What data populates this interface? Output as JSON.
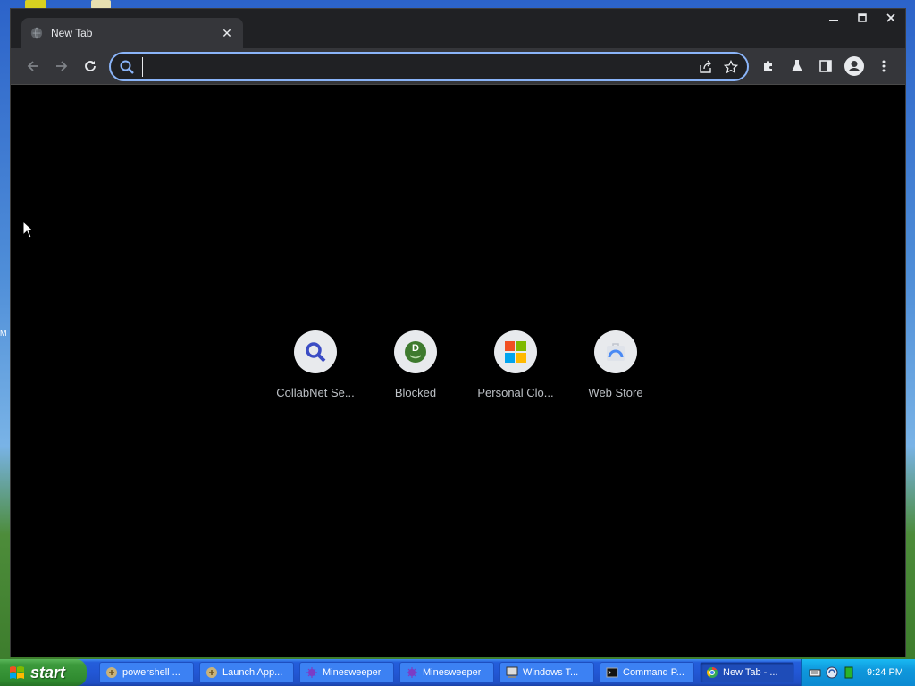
{
  "browser": {
    "tab": {
      "title": "New Tab",
      "close_glyph": "✕"
    },
    "omnibox": {
      "value": "",
      "placeholder": ""
    },
    "shortcuts": [
      {
        "label": "CollabNet Se...",
        "icon": "magnifier-icon"
      },
      {
        "label": "Blocked",
        "icon": "blocked-d-icon"
      },
      {
        "label": "Personal Clo...",
        "icon": "microsoft-logo-icon"
      },
      {
        "label": "Web Store",
        "icon": "web-store-icon"
      }
    ],
    "colors": {
      "accent": "#8ab4f8",
      "toolbar": "#35363a",
      "titlebar": "#202124",
      "page": "#000000"
    }
  },
  "desktop": {
    "edge_letter": "M"
  },
  "taskbar": {
    "start_label": "start",
    "tasks": [
      {
        "label": "powershell ...",
        "icon": "powershell-icon"
      },
      {
        "label": "Launch App...",
        "icon": "app-launcher-icon"
      },
      {
        "label": "Minesweeper",
        "icon": "minesweeper-icon"
      },
      {
        "label": "Minesweeper",
        "icon": "minesweeper-icon"
      },
      {
        "label": "Windows T...",
        "icon": "windows-terminal-icon"
      },
      {
        "label": "Command P...",
        "icon": "command-prompt-icon"
      },
      {
        "label": "New Tab - ...",
        "icon": "chrome-icon"
      }
    ],
    "clock": "9:24 PM"
  }
}
